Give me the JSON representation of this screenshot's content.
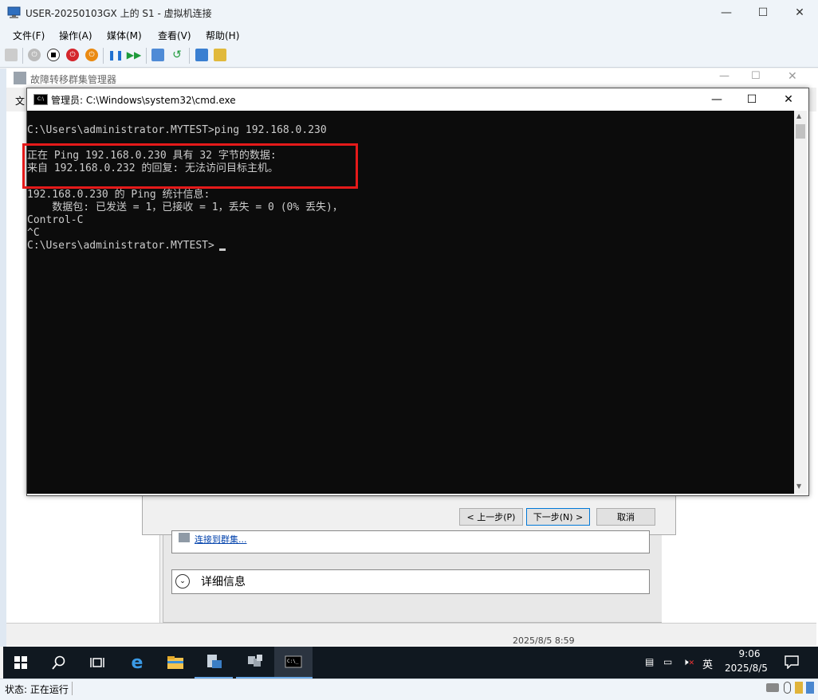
{
  "vm_window": {
    "title": "USER-20250103GX 上的 S1 - 虚拟机连接",
    "menu": [
      "文件(F)",
      "操作(A)",
      "媒体(M)",
      "查看(V)",
      "帮助(H)"
    ],
    "status": "状态: 正在运行"
  },
  "fcm_window": {
    "title": "故障转移群集管理器",
    "menu_first": "文",
    "connect_link": "连接到群集...",
    "details_label": "详细信息",
    "bg_timestamp": "2025/8/5 8:59",
    "wizard": {
      "back": "< 上一步(P)",
      "next": "下一步(N) >",
      "cancel": "取消"
    }
  },
  "cmd_window": {
    "title": "管理员: C:\\Windows\\system32\\cmd.exe",
    "lines": [
      "C:\\Users\\administrator.MYTEST>ping 192.168.0.230",
      "",
      "正在 Ping 192.168.0.230 具有 32 字节的数据:",
      "来自 192.168.0.232 的回复: 无法访问目标主机。",
      "",
      "192.168.0.230 的 Ping 统计信息:",
      "    数据包: 已发送 = 1，已接收 = 1，丢失 = 0 (0% 丢失)，",
      "Control-C",
      "^C",
      "C:\\Users\\administrator.MYTEST>"
    ]
  },
  "taskbar": {
    "ime": "英",
    "time": "9:06",
    "date": "2025/8/5"
  },
  "colors": {
    "highlight_box": "#e51a1a",
    "console_bg": "#0c0c0c",
    "taskbar_bg": "#101820"
  }
}
